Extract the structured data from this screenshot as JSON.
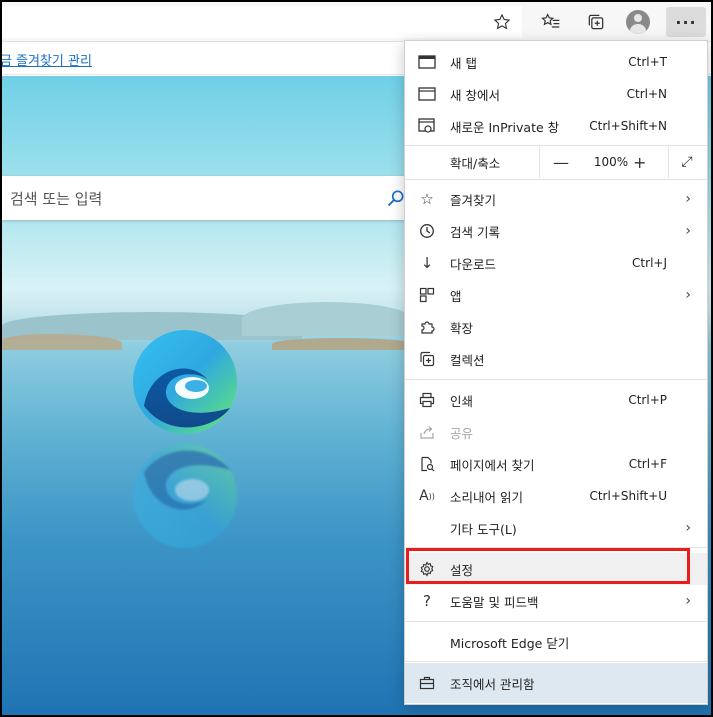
{
  "toolbar": {
    "star_icon": "star-outline-icon",
    "favorites_icon": "favorites-list-icon",
    "collections_icon": "collections-icon",
    "profile_icon": "profile-avatar-icon",
    "more_label": "···"
  },
  "favorites_bar": {
    "link_text": "지금 즐겨찾기 관리"
  },
  "search": {
    "placeholder": "검색 또는 입력"
  },
  "menu": {
    "new_tab": {
      "label": "새 탭",
      "shortcut": "Ctrl+T"
    },
    "new_window": {
      "label": "새 창에서",
      "shortcut": "Ctrl+N"
    },
    "inprivate": {
      "label": "새로운 InPrivate 창",
      "shortcut": "Ctrl+Shift+N"
    },
    "zoom": {
      "label": "확대/축소",
      "minus": "—",
      "value": "100%",
      "plus": "+",
      "fullscreen": "⤢"
    },
    "favorites": {
      "label": "즐겨찾기"
    },
    "history": {
      "label": "검색 기록"
    },
    "downloads": {
      "label": "다운로드",
      "shortcut": "Ctrl+J"
    },
    "apps": {
      "label": "앱"
    },
    "extensions": {
      "label": "확장"
    },
    "collections": {
      "label": "컬렉션"
    },
    "print": {
      "label": "인쇄",
      "shortcut": "Ctrl+P"
    },
    "share": {
      "label": "공유"
    },
    "find": {
      "label": "페이지에서 찾기",
      "shortcut": "Ctrl+F"
    },
    "read_aloud": {
      "label": "소리내어 읽기",
      "shortcut": "Ctrl+Shift+U"
    },
    "more_tools": {
      "label": "기타 도구(L)"
    },
    "settings": {
      "label": "설정"
    },
    "help": {
      "label": "도움말 및 피드백"
    },
    "close_edge": {
      "label": "Microsoft Edge 닫기"
    },
    "managed": {
      "label": "조직에서 관리함"
    }
  },
  "colors": {
    "highlight": "#e81e1e",
    "link": "#1a6fc4",
    "managed_bg": "#dde8f1"
  }
}
